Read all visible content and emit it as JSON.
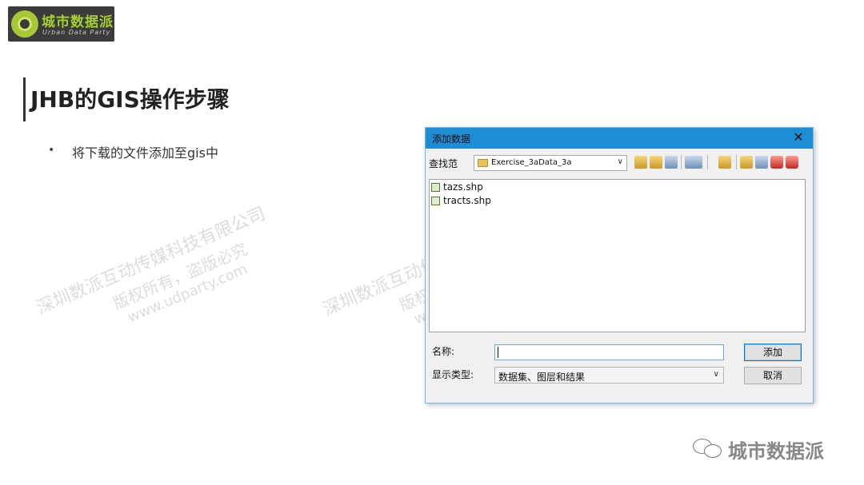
{
  "logo": {
    "text_cn": "城市数据派",
    "text_en": "Urban Data Party"
  },
  "slide": {
    "title": "JHB的GIS操作步骤",
    "bullet_marker": "•",
    "bullet_text": "将下载的文件添加至gis中"
  },
  "watermark": {
    "line1": "深圳数派互动传媒科技有限公司",
    "line2": "版权所有，盗版必究",
    "line3": "www.udparty.com"
  },
  "dialog": {
    "title": "添加数据",
    "close_glyph": "✕",
    "look_in_label": "查找范",
    "look_in_value": "Exercise_3aData_3a",
    "files": [
      "tazs.shp",
      "tracts.shp"
    ],
    "name_label": "名称:",
    "name_value": "",
    "type_label": "显示类型:",
    "type_value": "数据集、图层和结果",
    "add_button": "添加",
    "cancel_button": "取消"
  },
  "footer": {
    "brand": "城市数据派"
  }
}
